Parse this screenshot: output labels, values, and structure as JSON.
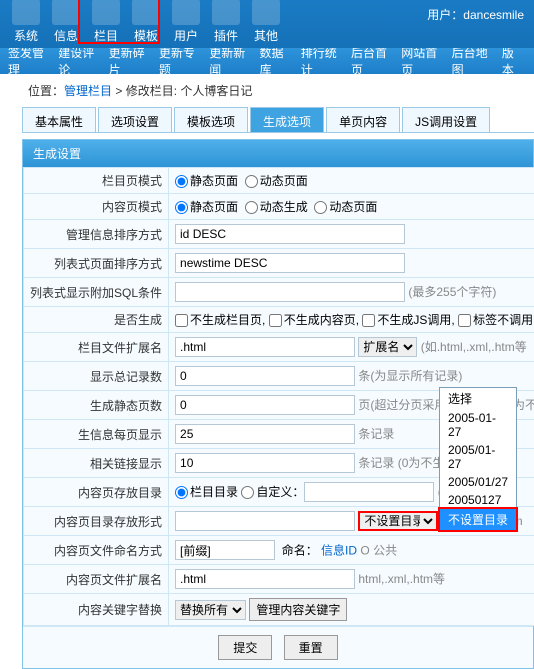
{
  "top": {
    "items": [
      "系统",
      "信息",
      "栏目",
      "模板",
      "用户",
      "插件",
      "其他"
    ],
    "user_label": "用户：",
    "user": "dancesmile"
  },
  "sub": [
    "签发管理",
    "建设评论",
    "更新碎片",
    "更新专题",
    "更新新闻",
    "数据库",
    "排行统计",
    "后台首页",
    "网站首页",
    "后台地图",
    "版本"
  ],
  "bc": {
    "loc": "位置：",
    "a": "管理栏目",
    "sep": " > 修改栏目: 个人博客日记"
  },
  "tabs": [
    "基本属性",
    "选项设置",
    "模板选项",
    "生成选项",
    "单页内容",
    "JS调用设置"
  ],
  "section": "生成设置",
  "rows": {
    "r1": {
      "l": "栏目页模式",
      "a": "静态页面",
      "b": "动态页面"
    },
    "r2": {
      "l": "内容页模式",
      "a": "静态页面",
      "b": "动态生成",
      "c": "动态页面"
    },
    "r3": {
      "l": "管理信息排序方式",
      "v": "id DESC"
    },
    "r4": {
      "l": "列表式页面排序方式",
      "v": "newstime DESC"
    },
    "r5": {
      "l": "列表式显示附加SQL条件",
      "h": "(最多255个字符)"
    },
    "r6": {
      "l": "是否生成",
      "a": "不生成栏目页,",
      "b": "不生成内容页,",
      "c": "不生成JS调用,",
      "d": "标签不调用"
    },
    "r7": {
      "l": "栏目文件扩展名",
      "v": ".html",
      "sel": "扩展名",
      "h": "(如.html,.xml,.htm等"
    },
    "r8": {
      "l": "显示总记录数",
      "v": "0",
      "h": "条(为显示所有记录)"
    },
    "r9": {
      "l": "生成静态页数",
      "v": "0",
      "h": "页(超过分页采用动态链接，0为不"
    },
    "r10": {
      "l": "生信息每页显示",
      "v": "25",
      "h": "条记录"
    },
    "r11": {
      "l": "相关链接显示",
      "v": "10",
      "h": "条记录 (0为不生成相关链接)"
    },
    "r12": {
      "l": "内容页存放目录",
      "a": "栏目目录",
      "b": "自定义：",
      "h": "(从根目录开始)"
    },
    "r13": {
      "l": "内容页目录存放形式",
      "sel": "不设置目录",
      "h": "(如Y-m-d、Y/m"
    },
    "r14": {
      "l": "内容页文件命名方式",
      "v": "[前缀]",
      "nm": "命名：",
      "link": "信息ID",
      "h": "O 公共"
    },
    "r15": {
      "l": "内容页文件扩展名",
      "v": ".html",
      "h": "html,.xml,.htm等"
    },
    "r16": {
      "l": "内容关键字替换",
      "b1": "替换所有",
      "b2": "管理内容关键字"
    }
  },
  "dd": {
    "items": [
      "选择",
      "2005-01-27",
      "2005/01-27",
      "2005/01/27",
      "20050127",
      "不设置目录"
    ]
  },
  "btns": {
    "a": "提交",
    "b": "重置"
  }
}
